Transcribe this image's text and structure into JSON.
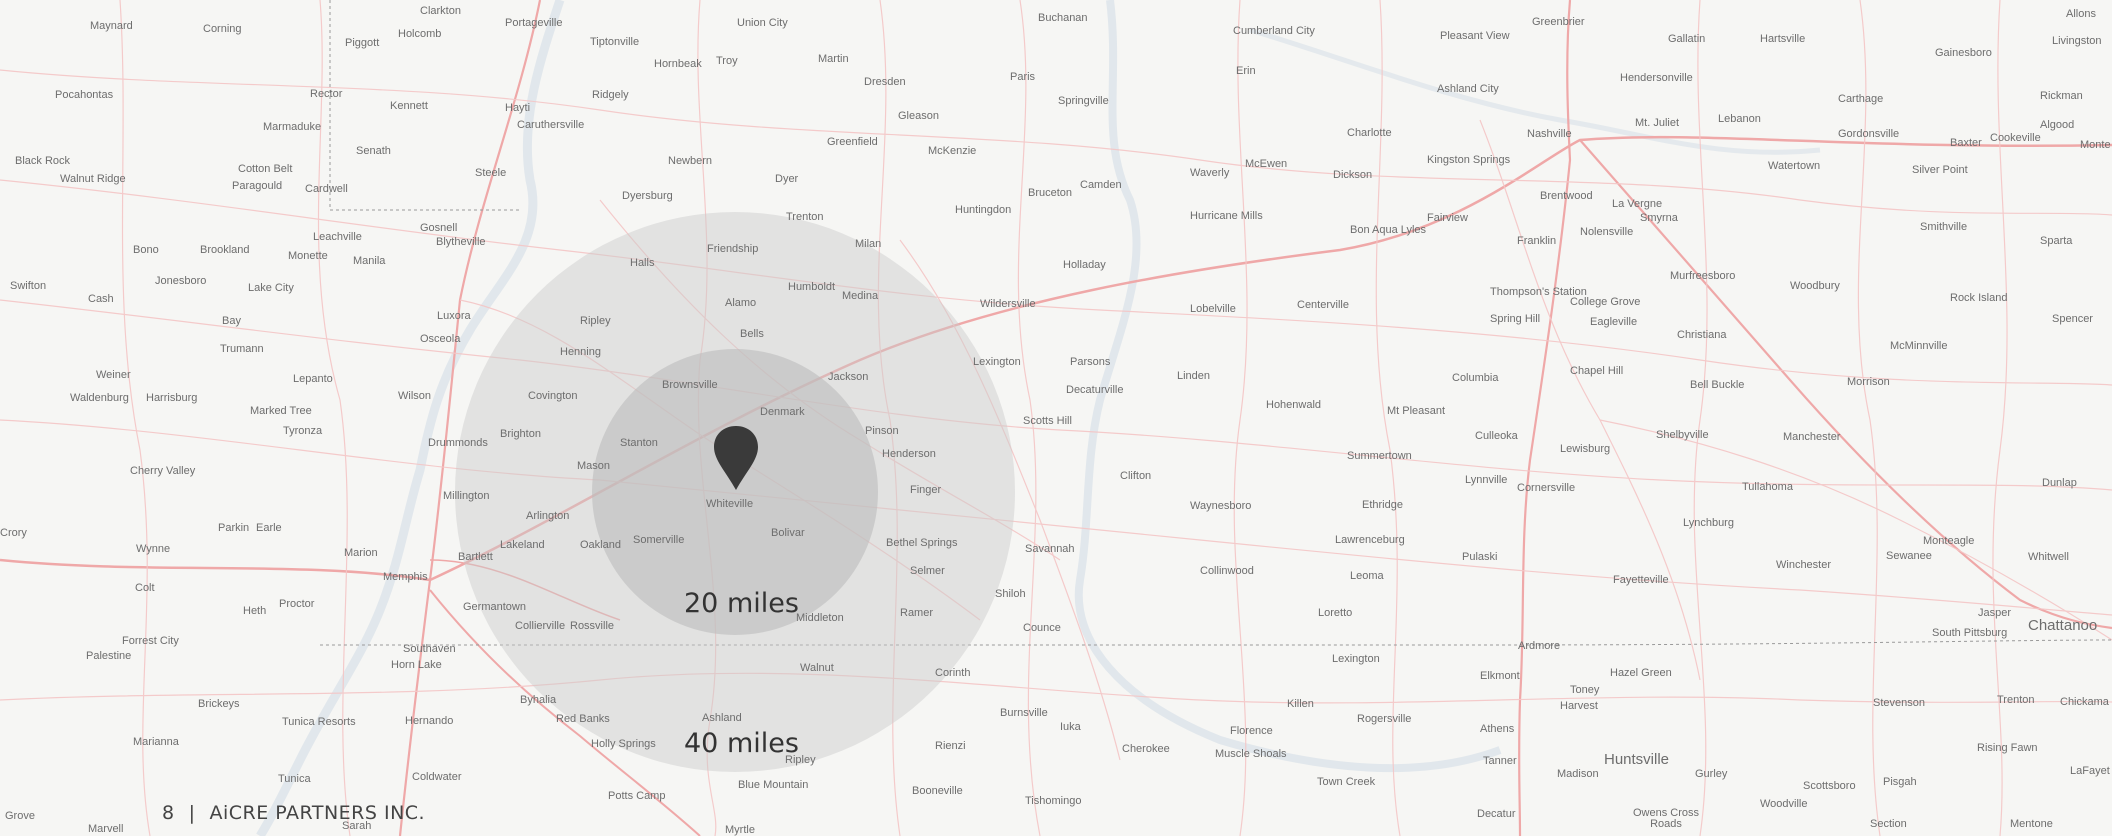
{
  "map": {
    "background": "#f6f6f4",
    "road_color": "#f1b8b8",
    "water_color": "#d9e1e8",
    "center_pin_color": "#3a3a3a",
    "places_major": {
      "memphis": "Memphis",
      "nashville": "Nashville",
      "huntsville": "Huntsville",
      "chattanooga": "Chattanoo"
    },
    "places": {
      "maynard": "Maynard",
      "corning": "Corning",
      "clarkton": "Clarkton",
      "holcomb": "Holcomb",
      "portageville": "Portageville",
      "union_city": "Union City",
      "tiptonville": "Tiptonville",
      "hornbeak": "Hornbeak",
      "troy": "Troy",
      "martin": "Martin",
      "dresden": "Dresden",
      "buchanan": "Buchanan",
      "paris": "Paris",
      "springville": "Springville",
      "cumberland_city": "Cumberland City",
      "erin": "Erin",
      "pleasant_view": "Pleasant View",
      "greenbrier": "Greenbrier",
      "gallatin": "Gallatin",
      "hartsville": "Hartsville",
      "allons": "Allons",
      "livingston": "Livingston",
      "gainesboro": "Gainesboro",
      "piggott": "Piggott",
      "pocahontas": "Pocahontas",
      "rector": "Rector",
      "kennett": "Kennett",
      "hayti": "Hayti",
      "ridgely": "Ridgely",
      "caruthersville": "Caruthersville",
      "marmaduke": "Marmaduke",
      "gleason": "Gleason",
      "ashland_city": "Ashland City",
      "hendersonville": "Hendersonville",
      "mt_juliet": "Mt. Juliet",
      "lebanon": "Lebanon",
      "carthage": "Carthage",
      "rickman": "Rickman",
      "gordonsville": "Gordonsville",
      "baxter": "Baxter",
      "cookeville": "Cookeville",
      "algood": "Algood",
      "black_rock": "Black Rock",
      "walnut_ridge": "Walnut Ridge",
      "cotton_belt": "Cotton Belt",
      "paragould": "Paragould",
      "cardwell": "Cardwell",
      "senath": "Senath",
      "steele": "Steele",
      "newbern": "Newbern",
      "greenfield": "Greenfield",
      "mckenzie": "McKenzie",
      "charlotte": "Charlotte",
      "dickson": "Dickson",
      "kingston_springs": "Kingston Springs",
      "mcewen": "McEwen",
      "waverly": "Waverly",
      "camden": "Camden",
      "bruceton": "Bruceton",
      "dyer": "Dyer",
      "dyersburg": "Dyersburg",
      "brentwood": "Brentwood",
      "la_vergne": "La Vergne",
      "smyrna": "Smyrna",
      "watertown": "Watertown",
      "silver_point": "Silver Point",
      "huntingdon": "Huntingdon",
      "trenton": "Trenton",
      "gosnell": "Gosnell",
      "blytheville": "Blytheville",
      "hurricane_mills": "Hurricane Mills",
      "bon_aqua": "Bon Aqua Lyles",
      "fairview": "Fairview",
      "franklin": "Franklin",
      "nolensville": "Nolensville",
      "smithville": "Smithville",
      "bono": "Bono",
      "brookland": "Brookland",
      "monette": "Monette",
      "manila": "Manila",
      "leachville": "Leachville",
      "friendship": "Friendship",
      "halls": "Halls",
      "milan": "Milan",
      "holladay": "Holladay",
      "murfreesboro": "Murfreesboro",
      "woodbury": "Woodbury",
      "sparta": "Sparta",
      "swifton": "Swifton",
      "jonesboro": "Jonesboro",
      "lake_city": "Lake City",
      "humboldt": "Humboldt",
      "medina": "Medina",
      "wildersville": "Wildersville",
      "lobelville": "Lobelville",
      "centerville": "Centerville",
      "thompsons_station": "Thompson's Station",
      "spring_hill": "Spring Hill",
      "college_grove": "College Grove",
      "eagleville": "Eagleville",
      "christiana": "Christiana",
      "rock_island": "Rock Island",
      "spencer": "Spencer",
      "cash": "Cash",
      "bay": "Bay",
      "luxora": "Luxora",
      "osceola": "Osceola",
      "ripley": "Ripley",
      "alamo": "Alamo",
      "bells": "Bells",
      "mcminnville": "McMinnville",
      "trumann": "Trumann",
      "henning": "Henning",
      "lexington": "Lexington",
      "parsons": "Parsons",
      "linden": "Linden",
      "columbia": "Columbia",
      "chapel_hill": "Chapel Hill",
      "weiner": "Weiner",
      "lepanto": "Lepanto",
      "jackson": "Jackson",
      "decaturville": "Decaturville",
      "hohenwald": "Hohenwald",
      "bell_buckle": "Bell Buckle",
      "morrison": "Morrison",
      "waldenburg": "Waldenburg",
      "harrisburg": "Harrisburg",
      "wilson": "Wilson",
      "covington": "Covington",
      "brownsville": "Brownsville",
      "denmark": "Denmark",
      "scotts_hill": "Scotts Hill",
      "mt_pleasant": "Mt Pleasant",
      "marked_tree": "Marked Tree",
      "tyronza": "Tyronza",
      "drummonds": "Drummonds",
      "brighton": "Brighton",
      "stanton": "Stanton",
      "pinson": "Pinson",
      "culleoka": "Culleoka",
      "lewisburg": "Lewisburg",
      "shelbyville": "Shelbyville",
      "manchester": "Manchester",
      "henderson": "Henderson",
      "summertown": "Summertown",
      "cherry_valley": "Cherry Valley",
      "mason": "Mason",
      "clifton": "Clifton",
      "lynnville": "Lynnville",
      "cornersville": "Cornersville",
      "tullahoma": "Tullahoma",
      "dunlap": "Dunlap",
      "millington": "Millington",
      "finger": "Finger",
      "waynesboro": "Waynesboro",
      "ethridge": "Ethridge",
      "arlington": "Arlington",
      "whiteville": "Whiteville",
      "parkin": "Parkin",
      "earle": "Earle",
      "lynchburg": "Lynchburg",
      "crory": "Crory",
      "bolivar": "Bolivar",
      "lawrenceburg": "Lawrenceburg",
      "monteagle": "Monteagle",
      "wynne": "Wynne",
      "lakeland": "Lakeland",
      "oakland": "Oakland",
      "somerville": "Somerville",
      "bethel_springs": "Bethel Springs",
      "savannah": "Savannah",
      "pulaski": "Pulaski",
      "whitwell": "Whitwell",
      "sewanee": "Sewanee",
      "winchester": "Winchester",
      "marion": "Marion",
      "bartlett": "Bartlett",
      "selmer": "Selmer",
      "collinwood": "Collinwood",
      "leoma": "Leoma",
      "fayetteville": "Fayetteville",
      "colt": "Colt",
      "shiloh": "Shiloh",
      "proctor": "Proctor",
      "heth": "Heth",
      "germantown": "Germantown",
      "ramer": "Ramer",
      "loretto": "Loretto",
      "jasper": "Jasper",
      "middleton": "Middleton",
      "collierville": "Collierville",
      "rossville": "Rossville",
      "counce": "Counce",
      "south_pittsburg": "South Pittsburg",
      "forrest_city": "Forrest City",
      "palestine": "Palestine",
      "southaven": "Southaven",
      "horn_lake": "Horn Lake",
      "ardmore": "Ardmore",
      "walnut": "Walnut",
      "corinth": "Corinth",
      "elkmont": "Elkmont",
      "hazel_green": "Hazel Green",
      "toney": "Toney",
      "harvest": "Harvest",
      "lexington_al": "Lexington",
      "byhalia": "Byhalia",
      "killen": "Killen",
      "rogersville": "Rogersville",
      "stevenson": "Stevenson",
      "trenton_ga": "Trenton",
      "chickamauga": "Chickama",
      "brickeys": "Brickeys",
      "tunica_resorts": "Tunica Resorts",
      "hernando": "Hernando",
      "red_banks": "Red Banks",
      "ashland": "Ashland",
      "burnsville": "Burnsville",
      "iuka": "Iuka",
      "athens": "Athens",
      "florence": "Florence",
      "muscle_shoals": "Muscle Shoals",
      "cherokee": "Cherokee",
      "rising_fawn": "Rising Fawn",
      "marianna": "Marianna",
      "holly_springs": "Holly Springs",
      "rienzi": "Rienzi",
      "ripley_ms": "Ripley",
      "tanner": "Tanner",
      "madison": "Madison",
      "gurley": "Gurley",
      "lafayette": "LaFayet",
      "tunica": "Tunica",
      "coldwater": "Coldwater",
      "blue_mountain": "Blue Mountain",
      "booneville": "Booneville",
      "town_creek": "Town Creek",
      "scottsboro": "Scottsboro",
      "pisgah": "Pisgah",
      "potts_camp": "Potts Camp",
      "tishomingo": "Tishomingo",
      "decatur": "Decatur",
      "owens_cross_roads": "Owens Cross Roads",
      "woodville": "Woodville",
      "section": "Section",
      "mentone": "Mentone",
      "grove": "Grove",
      "sarah": "Sarah",
      "marvell": "Marvell",
      "myrtle": "Myrtle",
      "monterey": "Monte"
    }
  },
  "rings": {
    "inner_label": "20 miles",
    "outer_label": "40 miles",
    "fill_color": "#c9c9c9"
  },
  "footer": {
    "page_number": "8",
    "separator": "|",
    "company": "AiCRE PARTNERS INC."
  }
}
